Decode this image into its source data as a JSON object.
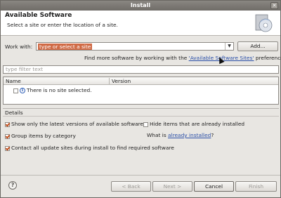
{
  "window": {
    "title": "Install",
    "close_glyph": "✕"
  },
  "banner": {
    "title": "Available Software",
    "description": "Select a site or enter the location of a site."
  },
  "work_with": {
    "label": "Work with:",
    "value": "type or select a site",
    "add_label": "Add...",
    "dropdown_glyph": "▼"
  },
  "find_more": {
    "prefix": "Find more software by working with the ",
    "link": "'Available Software Sites'",
    "suffix": " preferences."
  },
  "filter": {
    "placeholder": "type filter text"
  },
  "table": {
    "columns": [
      "Name",
      "Version"
    ],
    "rows": [
      {
        "name": "There is no site selected.",
        "checked": false
      }
    ]
  },
  "details": {
    "label": "Details"
  },
  "options": {
    "latest_versions": {
      "label": "Show only the latest versions of available software",
      "checked": true
    },
    "group_by_category": {
      "label": "Group items by category",
      "checked": true
    },
    "contact_sites": {
      "label": "Contact all update sites during install to find required software",
      "checked": true
    },
    "hide_installed": {
      "label": "Hide items that are already installed",
      "checked": false
    },
    "what_is": {
      "prefix": "What is ",
      "link": "already installed",
      "suffix": "?"
    }
  },
  "buttons": {
    "help": "?",
    "back": "< Back",
    "next": "Next >",
    "cancel": "Cancel",
    "finish": "Finish"
  },
  "icons": {
    "window_close": "close-icon",
    "banner": "software-cd-icon",
    "info": "info-icon",
    "help": "help-icon"
  },
  "colors": {
    "accent": "#d06a45",
    "link": "#2a4fa8",
    "check": "#c0501f"
  }
}
